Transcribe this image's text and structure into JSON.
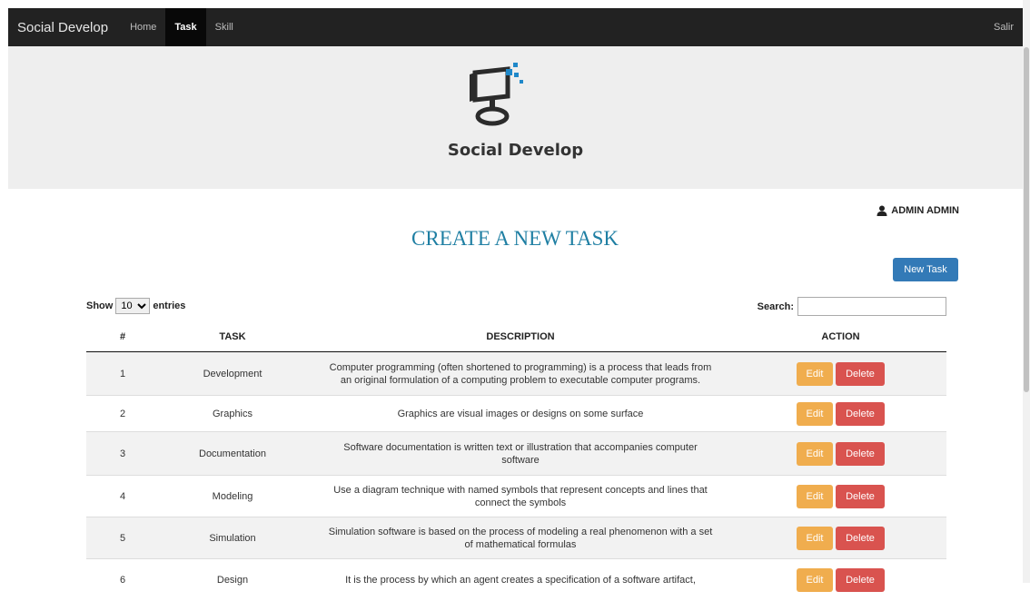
{
  "nav": {
    "brand": "Social Develop",
    "items": [
      {
        "label": "Home",
        "active": false
      },
      {
        "label": "Task",
        "active": true
      },
      {
        "label": "Skill",
        "active": false
      }
    ],
    "logout": "Salir"
  },
  "hero": {
    "title": "Social Develop",
    "logo_icon": "monitor-logo-icon"
  },
  "user": {
    "icon": "user-icon",
    "name": "ADMIN ADMIN"
  },
  "page": {
    "title": "CREATE A NEW TASK",
    "new_button": "New Task"
  },
  "table_controls": {
    "show_label": "Show",
    "entries_label": "entries",
    "page_size": "10",
    "search_label": "Search:",
    "search_value": ""
  },
  "table": {
    "headers": [
      "#",
      "TASK",
      "DESCRIPTION",
      "ACTION"
    ],
    "edit_label": "Edit",
    "delete_label": "Delete",
    "rows": [
      {
        "id": "1",
        "task": "Development",
        "description": [
          "Computer programming (often shortened to programming) is a process that leads from",
          "an original formulation of a computing problem to executable computer programs."
        ]
      },
      {
        "id": "2",
        "task": "Graphics",
        "description": [
          "Graphics are visual images or designs on some surface",
          ""
        ]
      },
      {
        "id": "3",
        "task": "Documentation",
        "description": [
          "Software documentation is written text or illustration that accompanies computer",
          "software"
        ]
      },
      {
        "id": "4",
        "task": "Modeling",
        "description": [
          "Use a diagram technique with named symbols that represent concepts and lines that",
          "connect the symbols"
        ]
      },
      {
        "id": "5",
        "task": "Simulation",
        "description": [
          "Simulation software is based on the process of modeling a real phenomenon with a set",
          "of mathematical formulas"
        ]
      },
      {
        "id": "6",
        "task": "Design",
        "description": [
          "It is the process by which an agent creates a specification of a software artifact,",
          ""
        ]
      }
    ]
  },
  "colors": {
    "navbar": "#222222",
    "hero_bg": "#eeeeee",
    "title": "#1f7fa3",
    "primary": "#337ab7",
    "edit": "#f0ad4e",
    "delete": "#d9534f"
  }
}
